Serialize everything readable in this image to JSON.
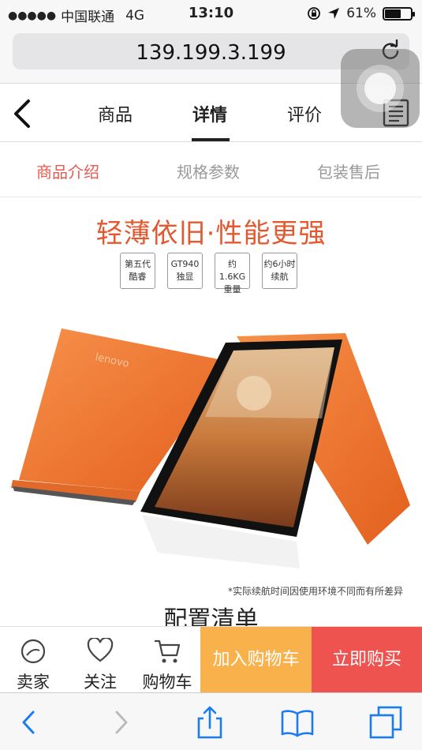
{
  "status_bar": {
    "signal_dots": "●●●●●",
    "carrier": "中国联通",
    "network": "4G",
    "time": "13:10",
    "battery_percent": "61%",
    "battery_level": 0.61,
    "icons": [
      "orientation-lock-icon",
      "location-arrow-icon",
      "battery-icon"
    ]
  },
  "address_bar": {
    "url": "139.199.3.199",
    "reload_icon": "reload-icon"
  },
  "nav": {
    "back_icon": "chevron-left-icon",
    "tabs": [
      {
        "label": "商品",
        "active": false
      },
      {
        "label": "详情",
        "active": true
      },
      {
        "label": "评价",
        "active": false
      }
    ],
    "menu_icon": "list-document-icon"
  },
  "subtabs": [
    {
      "label": "商品介绍",
      "active": true
    },
    {
      "label": "规格参数",
      "active": false
    },
    {
      "label": "包装售后",
      "active": false
    }
  ],
  "hero": {
    "headline": "轻薄依旧·性能更强",
    "chips": [
      {
        "line1": "第五代",
        "line2": "酷睿"
      },
      {
        "line1": "GT940",
        "line2": "独显"
      },
      {
        "line1": "约1.6KG",
        "line2": "重量"
      },
      {
        "line1": "约6小时",
        "line2": "续航"
      }
    ],
    "laptop_brand": "lenovo",
    "notice": "*实际续航时间因使用环境不同而有所差异",
    "accent_color": "#e4582f"
  },
  "config_title": "配置清单",
  "action_bar": {
    "seller_label": "卖家",
    "follow_label": "关注",
    "cart_label": "购物车",
    "add_to_cart_label": "加入购物车",
    "buy_now_label": "立即购买",
    "add_to_cart_color": "#f9b24b",
    "buy_now_color": "#ef5350"
  },
  "toolbar": {
    "icons": [
      "back-arrow-icon",
      "forward-arrow-icon",
      "share-icon",
      "bookmarks-icon",
      "tabs-icon"
    ]
  }
}
